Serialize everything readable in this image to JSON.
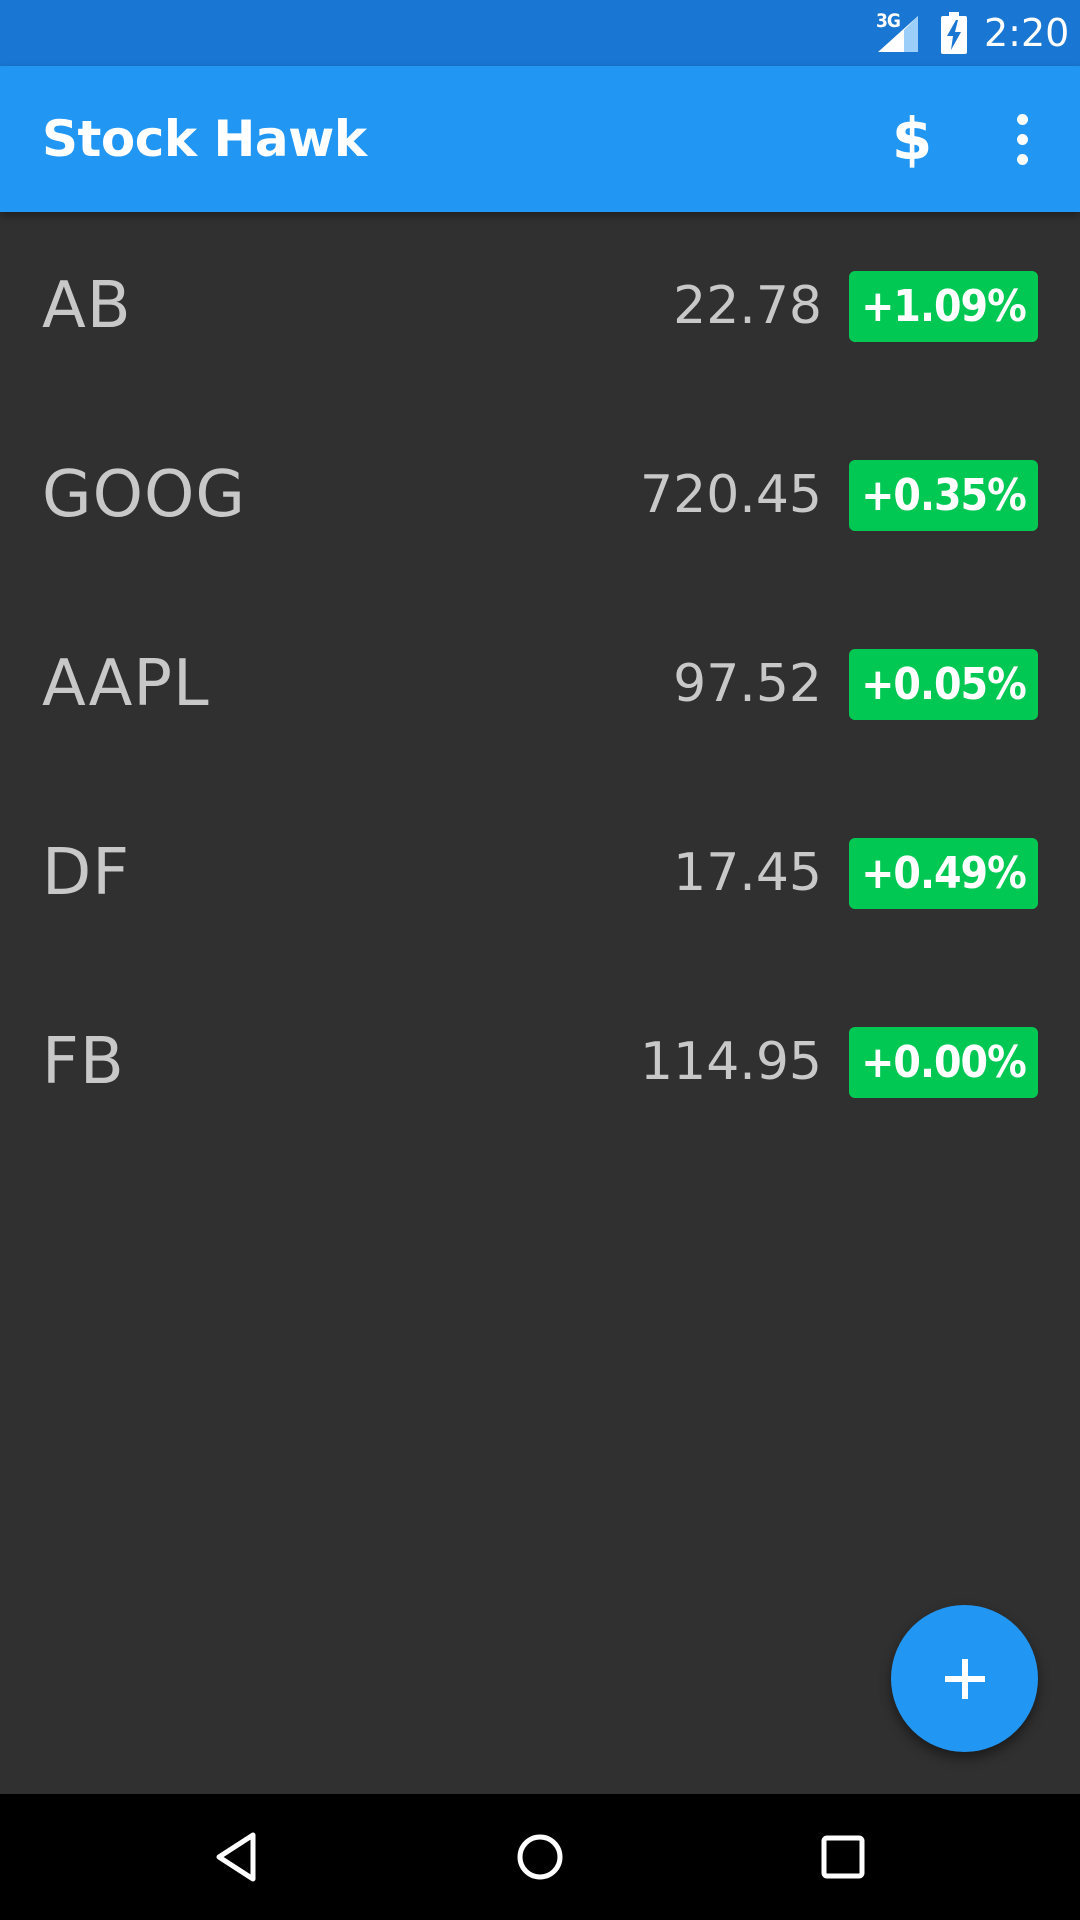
{
  "status_bar": {
    "network_type": "3G",
    "network_icon": "signal-icon",
    "battery_icon": "battery-charging-icon",
    "time": "2:20"
  },
  "app_bar": {
    "title": "Stock Hawk",
    "currency_icon": "$",
    "overflow_icon": "more-vert-icon"
  },
  "stocks": [
    {
      "symbol": "AB",
      "price": "22.78",
      "change": "+1.09%"
    },
    {
      "symbol": "GOOG",
      "price": "720.45",
      "change": "+0.35%"
    },
    {
      "symbol": "AAPL",
      "price": "97.52",
      "change": "+0.05%"
    },
    {
      "symbol": "DF",
      "price": "17.45",
      "change": "+0.49%"
    },
    {
      "symbol": "FB",
      "price": "114.95",
      "change": "+0.00%"
    }
  ],
  "fab": {
    "icon": "add-icon"
  },
  "nav_bar": {
    "back_icon": "back-icon",
    "home_icon": "home-icon",
    "recents_icon": "recents-icon"
  },
  "colors": {
    "status_bar": "#1976d2",
    "app_bar": "#2196f3",
    "background": "#303030",
    "change_positive": "#00c853",
    "fab": "#2196f3"
  }
}
